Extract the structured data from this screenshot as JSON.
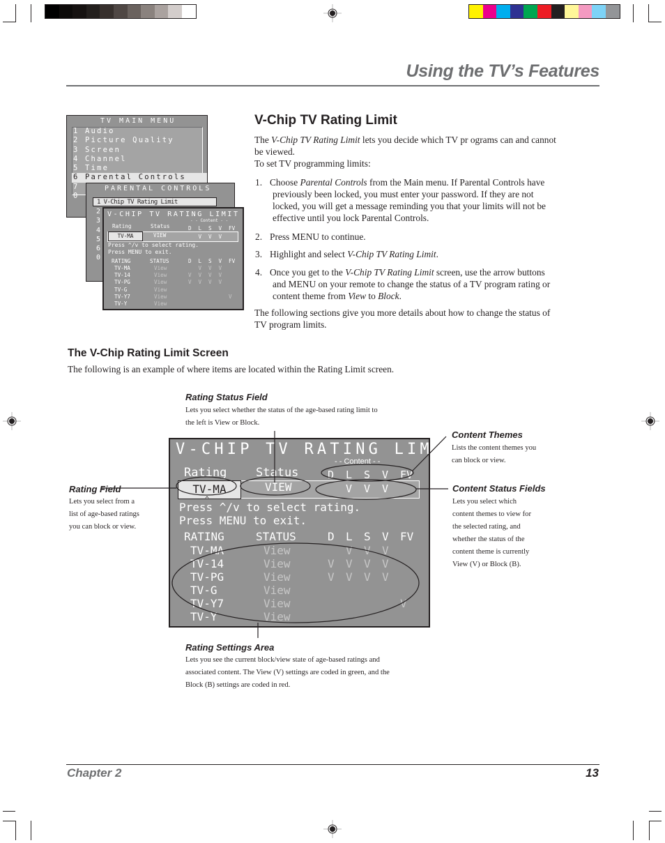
{
  "print_marks": {
    "gray_swatches": [
      "#000000",
      "#0d0b0a",
      "#161211",
      "#231f1d",
      "#37302d",
      "#4f4744",
      "#6a625e",
      "#8a827e",
      "#aaa29f",
      "#d3cdcb",
      "#ffffff"
    ],
    "color_swatches": [
      "#fff200",
      "#ec008c",
      "#00aeef",
      "#2e3192",
      "#00a651",
      "#ed1c24",
      "#231f20",
      "#fff799",
      "#f49ac1",
      "#7dd3f7",
      "#939598"
    ]
  },
  "header": {
    "title": "Using the TV’s Features"
  },
  "main_menu": {
    "title": "TV MAIN MENU",
    "items": [
      {
        "num": "1",
        "label": "Audio"
      },
      {
        "num": "2",
        "label": "Picture Quality"
      },
      {
        "num": "3",
        "label": "Screen"
      },
      {
        "num": "4",
        "label": "Channel"
      },
      {
        "num": "5",
        "label": "Time"
      },
      {
        "num": "6",
        "label": "Parental Controls"
      },
      {
        "num": "7",
        "label": ""
      },
      {
        "num": "0",
        "label": ""
      }
    ]
  },
  "parental_menu": {
    "title": "PARENTAL CONTROLS",
    "selected_item": "1 V-Chip TV Rating Limit",
    "nums": [
      "2",
      "3",
      "4",
      "5",
      "6",
      "0"
    ]
  },
  "vchip_screen": {
    "title": "V-CHIP TV RATING LIMIT",
    "content_label": "- - Content - -",
    "rating_header": "Rating",
    "status_header": "Status",
    "theme_headers": [
      "D",
      "L",
      "S",
      "V",
      "FV"
    ],
    "selected_rating": "TV-MA",
    "selected_status": "VIEW",
    "selected_themes": [
      "",
      "V",
      "V",
      "V",
      ""
    ],
    "cursor": "^",
    "instructions": [
      "Press ^/v to select rating.",
      "Press MENU to exit."
    ],
    "table_headers": {
      "rating": "RATING",
      "status": "STATUS",
      "themes": [
        "D",
        "L",
        "S",
        "V",
        "FV"
      ]
    },
    "rows": [
      {
        "rating": "TV-MA",
        "status": "View",
        "themes": [
          "",
          "V",
          "V",
          "V",
          ""
        ]
      },
      {
        "rating": "TV-14",
        "status": "View",
        "themes": [
          "V",
          "V",
          "V",
          "V",
          ""
        ]
      },
      {
        "rating": "TV-PG",
        "status": "View",
        "themes": [
          "V",
          "V",
          "V",
          "V",
          ""
        ]
      },
      {
        "rating": "TV-G",
        "status": "View",
        "themes": [
          "",
          "",
          "",
          "",
          ""
        ]
      },
      {
        "rating": "TV-Y7",
        "status": "View",
        "themes": [
          "",
          "",
          "",
          "",
          "V"
        ]
      },
      {
        "rating": "TV-Y",
        "status": "View",
        "themes": [
          "",
          "",
          "",
          "",
          ""
        ]
      }
    ]
  },
  "section1": {
    "heading": "V-Chip TV Rating Limit",
    "intro_pre": "The ",
    "intro_italic": "V-Chip TV Rating Limit",
    "intro_post": " lets you decide which TV pr ograms can and cannot",
    "intro_line2": "be viewed.",
    "intro_line3": "To set TV programming limits:",
    "steps": [
      {
        "num": "1.",
        "lines": [
          "Choose |Parental Controls| from the Main menu. If Parental Controls have",
          "previously been locked, you must enter your password. If they are not",
          "locked, you will get a message reminding you that your limits will not be",
          "effective until you lock Parental Controls."
        ]
      },
      {
        "num": "2.",
        "lines": [
          "Press MENU to continue."
        ]
      },
      {
        "num": "3.",
        "lines": [
          "Highlight and select |V-Chip TV Rating Limit|."
        ]
      },
      {
        "num": "4.",
        "lines": [
          "Once you get to the |V-Chip TV Rating Limit| screen, use the arrow buttons",
          "and MENU on your remote to change the status of a TV program rating or",
          "content theme from |View| to |Block|."
        ]
      }
    ],
    "closing": [
      "The following sections give you more details about how to change the status of",
      "TV program limits."
    ]
  },
  "section2": {
    "heading": "The V-Chip Rating Limit Screen",
    "intro": "The following is an example of where items are located within the Rating Limit screen."
  },
  "callouts": {
    "rating_status_field": {
      "title": "Rating Status Field",
      "lines": [
        "Lets you select whether the status of the age-based rating limit to",
        "the left is View or Block."
      ]
    },
    "content_themes": {
      "title": "Content Themes",
      "lines": [
        "Lists the content themes you",
        "can block or view."
      ]
    },
    "rating_field": {
      "title": "Rating Field",
      "lines": [
        "Lets you select from a",
        "list of age-based ratings",
        "you can block or view."
      ]
    },
    "content_status_fields": {
      "title": "Content Status Fields",
      "lines": [
        "Lets you select which",
        "content themes to view for",
        "the selected rating, and",
        "whether the status of the",
        "content theme is currently",
        "View (V) or Block (B)."
      ]
    },
    "rating_settings_area": {
      "title": "Rating Settings Area",
      "lines": [
        "Lets you see the current block/view state of age-based ratings and",
        "associated content. The View (V) settings are coded in green, and the",
        "Block (B) settings are coded in red."
      ]
    }
  },
  "footer": {
    "chapter": "Chapter 2",
    "page": "13"
  }
}
